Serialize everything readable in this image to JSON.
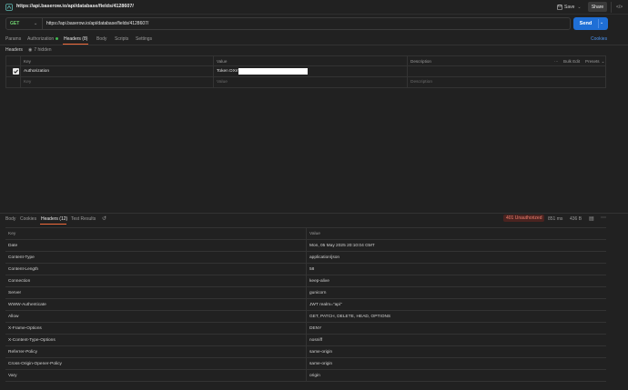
{
  "titlebar": {
    "title": "https://api.baserow.io/api/database/fields/4128607/",
    "save_label": "Save",
    "share_label": "Share",
    "code_label": "</>"
  },
  "request": {
    "method": "GET",
    "url": "https://api.baserow.io/api/database/fields/4128607/",
    "send_label": "Send"
  },
  "request_tabs": {
    "items": [
      {
        "label": "Params"
      },
      {
        "label": "Authorization"
      },
      {
        "label": "Headers (8)"
      },
      {
        "label": "Body"
      },
      {
        "label": "Scripts"
      },
      {
        "label": "Settings"
      }
    ],
    "cookies_label": "Cookies"
  },
  "headers_section": {
    "label": "Headers",
    "hidden_label": "7 hidden",
    "columns": {
      "key": "Key",
      "value": "Value",
      "description": "Description"
    },
    "bulk_edit": "Bulk Edit",
    "presets": "Presets",
    "rows": [
      {
        "key": "Authorization",
        "value": "Token DXm",
        "checked": true
      }
    ],
    "placeholder": {
      "key": "Key",
      "value": "Value",
      "description": "Description"
    }
  },
  "response_tabs": {
    "items": [
      {
        "label": "Body"
      },
      {
        "label": "Cookies"
      },
      {
        "label": "Headers (12)"
      },
      {
        "label": "Test Results"
      }
    ],
    "status": "401 Unauthorized",
    "time": "851 ms",
    "size": "436 B"
  },
  "response_headers": {
    "columns": {
      "key": "Key",
      "value": "Value"
    },
    "rows": [
      {
        "key": "Date",
        "value": "Mon, 05 May 2025 20:10:04 GMT"
      },
      {
        "key": "Content-Type",
        "value": "application/json"
      },
      {
        "key": "Content-Length",
        "value": "58"
      },
      {
        "key": "Connection",
        "value": "keep-alive"
      },
      {
        "key": "Server",
        "value": "gunicorn"
      },
      {
        "key": "WWW-Authenticate",
        "value": "JWT realm=\"api\""
      },
      {
        "key": "Allow",
        "value": "GET, PATCH, DELETE, HEAD, OPTIONS"
      },
      {
        "key": "X-Frame-Options",
        "value": "DENY"
      },
      {
        "key": "X-Content-Type-Options",
        "value": "nosniff"
      },
      {
        "key": "Referrer-Policy",
        "value": "same-origin"
      },
      {
        "key": "Cross-Origin-Opener-Policy",
        "value": "same-origin"
      },
      {
        "key": "Vary",
        "value": "origin"
      }
    ]
  },
  "colors": {
    "accent": "#f26b3a",
    "send": "#1f6fd6",
    "method_get": "#6fcf6f",
    "status_error": "#f07f6e"
  }
}
